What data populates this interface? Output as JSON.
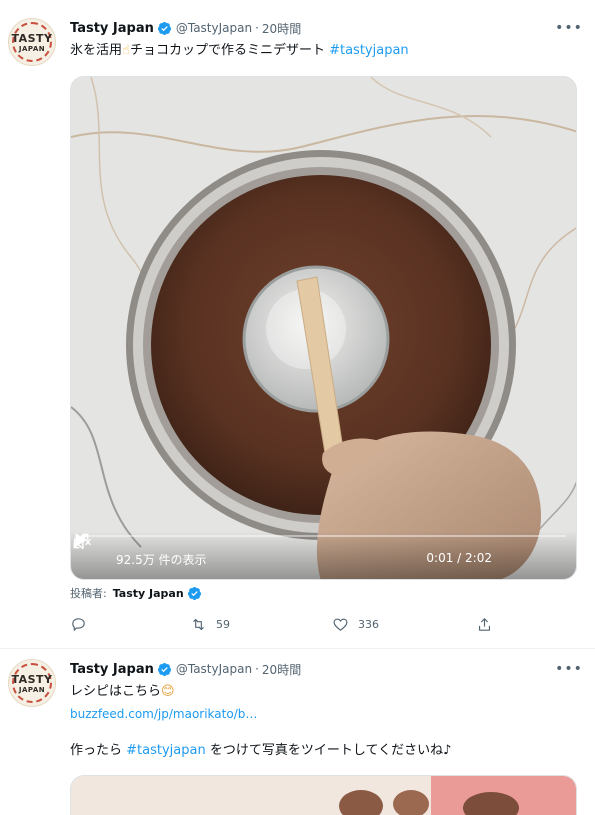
{
  "tweets": [
    {
      "display_name": "Tasty Japan",
      "handle": "@TastyJapan",
      "separator": "·",
      "time": "20時間",
      "avatar_text_line1": "TASTY",
      "avatar_text_line2": "JAPAN",
      "text_before": "氷を活用",
      "emoji": "☝",
      "text_after": "チョコカップで作るミニデザート",
      "hashtag": "#tastyjapan",
      "video": {
        "views": "92.5万 件の表示",
        "time": "0:01 / 2:02",
        "progress": 0.01
      },
      "byline_label": "投稿者:",
      "byline_name": "Tasty Japan",
      "actions": {
        "reply_count": "",
        "retweet_count": "59",
        "like_count": "336",
        "share_count": ""
      }
    },
    {
      "display_name": "Tasty Japan",
      "handle": "@TastyJapan",
      "separator": "·",
      "time": "20時間",
      "avatar_text_line1": "TASTY",
      "avatar_text_line2": "JAPAN",
      "line1": "レシピはこちら",
      "line1_emoji": "😊",
      "link": "buzzfeed.com/jp/maorikato/b…",
      "line3_before": "作ったら",
      "line3_hashtag": "#tastyjapan",
      "line3_after": "をつけて写真をツイートしてくださいね♪"
    }
  ],
  "colors": {
    "accent": "#1d9bf0",
    "secondary_text": "#536471",
    "primary_text": "#0f1419"
  },
  "icons": [
    "verified-badge-icon",
    "more-icon",
    "play-icon",
    "volume-icon",
    "fullscreen-icon",
    "reply-icon",
    "retweet-icon",
    "like-icon",
    "share-icon"
  ]
}
